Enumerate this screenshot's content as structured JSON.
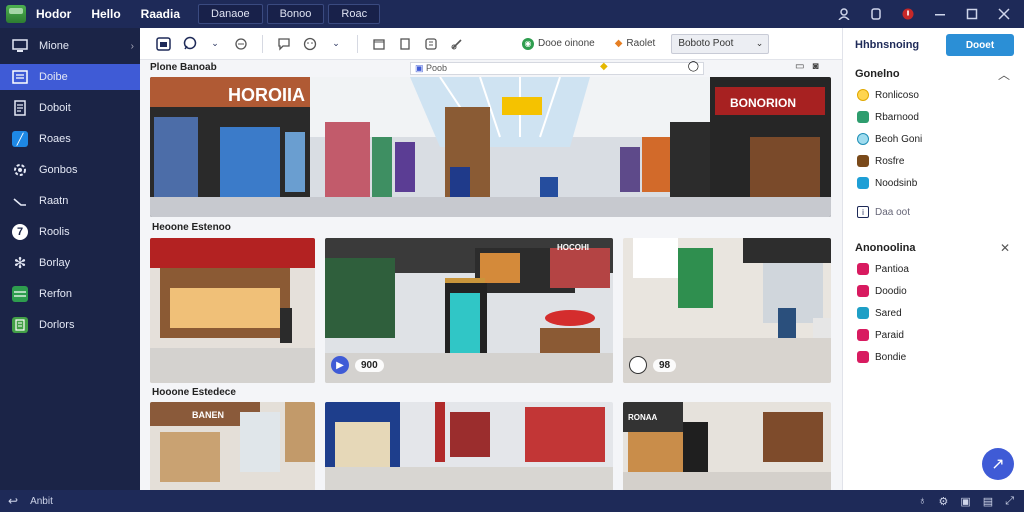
{
  "titlebar": {
    "menu": [
      "Hodor",
      "Hello",
      "Raadia"
    ],
    "tabs": [
      "Danaoe",
      "Bonoo",
      "Roac"
    ]
  },
  "sidebar": {
    "items": [
      {
        "label": "Mione",
        "icon": "monitor-icon"
      },
      {
        "label": "Doibe",
        "icon": "list-icon",
        "active": true
      },
      {
        "label": "Doboit",
        "icon": "document-icon"
      },
      {
        "label": "Roaes",
        "icon": "chart-icon"
      },
      {
        "label": "Gonbos",
        "icon": "settings-icon"
      },
      {
        "label": "Raatn",
        "icon": "pen-icon"
      },
      {
        "label": "Roolis",
        "icon": "gauge-icon"
      },
      {
        "label": "Borlay",
        "icon": "gear-icon"
      },
      {
        "label": "Rerfon",
        "icon": "table-icon"
      },
      {
        "label": "Dorlors",
        "icon": "sheet-icon"
      }
    ]
  },
  "toolbar": {
    "filter_label": "Dooe oinone",
    "sort_label": "Raolet",
    "select_value": "Boboto Poot"
  },
  "main": {
    "section_title": "Plone Banoab",
    "search_text": "Poob",
    "hero_sign_left": "HOROIIA",
    "hero_sign_right": "BONORION",
    "group1_label": "Heoone Estenoo",
    "group2_label": "Hooone Estedece",
    "thumb2_sign": "HOCOHI",
    "thumb1_badge": "900",
    "thumb3_badge": "98",
    "thumb4_sign": "BANEN",
    "thumb6_sign": "RONAA"
  },
  "rpanel": {
    "title": "Hhbnsnoing",
    "button": "Dooet",
    "section1": "Gonelno",
    "items1": [
      "Ronlicoso",
      "Rbarnood",
      "Beoh Goni",
      "Rosfre",
      "Noodsinb"
    ],
    "mini_text": "Daa oot",
    "section2": "Anonoolina",
    "items2": [
      "Pantioa",
      "Doodio",
      "Sared",
      "Paraid",
      "Bondie"
    ]
  },
  "statusbar": {
    "text": "Anbit"
  },
  "colors": {
    "titlebar": "#1e2a58",
    "sidebar": "#1b2447",
    "accent": "#3f5bd6",
    "button": "#2b8fd6"
  }
}
